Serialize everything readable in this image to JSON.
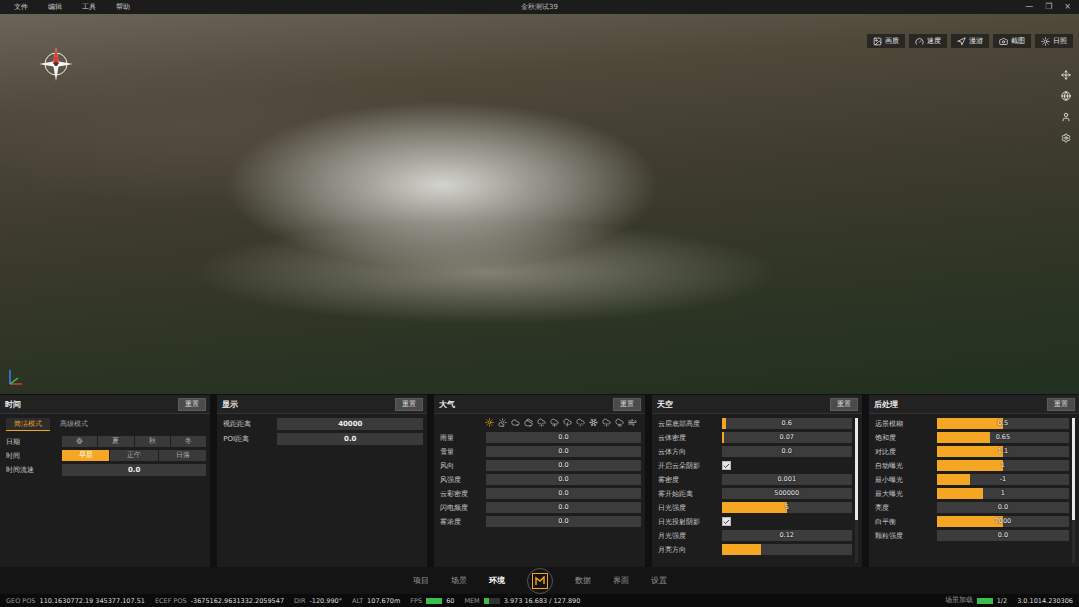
{
  "window": {
    "title": "金秋测试39",
    "menu": [
      "文件",
      "编辑",
      "工具",
      "帮助"
    ],
    "controls": [
      "—",
      "❐",
      "×"
    ]
  },
  "viewport_toolbar": [
    "画质",
    "速度",
    "漫游",
    "截图",
    "日照"
  ],
  "panels": [
    {
      "title": "时间",
      "reset": "重置",
      "scrollbar": false,
      "tabs": [
        {
          "label": "简洁模式",
          "selected": true
        },
        {
          "label": "高级模式",
          "selected": false
        }
      ],
      "rows": [
        {
          "kind": "segmented",
          "label": "日期",
          "options": [
            {
              "label": "春",
              "selected": false
            },
            {
              "label": "夏",
              "selected": false
            },
            {
              "label": "秋",
              "selected": false
            },
            {
              "label": "冬",
              "selected": false
            }
          ]
        },
        {
          "kind": "segmented",
          "label": "时间",
          "options": [
            {
              "label": "早晨",
              "selected": true
            },
            {
              "label": "正午",
              "selected": false
            },
            {
              "label": "日落",
              "selected": false
            }
          ]
        },
        {
          "kind": "field",
          "label": "时间流速",
          "value": "0.0"
        }
      ]
    },
    {
      "title": "显示",
      "reset": "重置",
      "scrollbar": false,
      "rows": [
        {
          "kind": "field",
          "label": "视距距离",
          "value": "40000"
        },
        {
          "kind": "field",
          "label": "POI距离",
          "value": "0.0"
        }
      ]
    },
    {
      "title": "大气",
      "reset": "重置",
      "scrollbar": false,
      "presets": [
        {
          "selected": true
        },
        {
          "selected": false
        },
        {
          "selected": false
        },
        {
          "selected": false
        },
        {
          "selected": false
        },
        {
          "selected": false
        },
        {
          "selected": false
        },
        {
          "selected": false
        },
        {
          "selected": false
        },
        {
          "selected": false
        },
        {
          "selected": false
        },
        {
          "selected": false
        }
      ],
      "rows": [
        {
          "kind": "slider",
          "label": "雨量",
          "value": "0.0",
          "level": 0
        },
        {
          "kind": "slider",
          "label": "雪量",
          "value": "0.0",
          "level": 0
        },
        {
          "kind": "slider",
          "label": "风向",
          "value": "0.0",
          "level": 0
        },
        {
          "kind": "slider",
          "label": "风强度",
          "value": "0.0",
          "level": 0
        },
        {
          "kind": "slider",
          "label": "云彩密度",
          "value": "0.0",
          "level": 0
        },
        {
          "kind": "slider",
          "label": "闪电频度",
          "value": "0.0",
          "level": 0
        },
        {
          "kind": "slider",
          "label": "雾浓度",
          "value": "0.0",
          "level": 0
        }
      ]
    },
    {
      "title": "天空",
      "reset": "重置",
      "scrollbar": true,
      "rows": [
        {
          "kind": "slider",
          "label": "云层底部高度",
          "value": "0.6",
          "level": 0.03
        },
        {
          "kind": "slider",
          "label": "云体密度",
          "value": "0.07",
          "level": 0.02
        },
        {
          "kind": "slider",
          "label": "云体方向",
          "value": "0.0",
          "level": 0
        },
        {
          "kind": "checkbox",
          "label": "开启云朵阴影",
          "checked": true
        },
        {
          "kind": "slider",
          "label": "雾密度",
          "value": "0.001",
          "level": 0
        },
        {
          "kind": "slider",
          "label": "雾开始距离",
          "value": "500000",
          "level": 0
        },
        {
          "kind": "slider",
          "label": "日光强度",
          "value": "5",
          "level": 0.5
        },
        {
          "kind": "checkbox",
          "label": "日光投射阴影",
          "checked": true
        },
        {
          "kind": "slider",
          "label": "月光强度",
          "value": "0.12",
          "level": 0
        },
        {
          "kind": "slider",
          "label": "月亮方向",
          "level": 0.3
        }
      ]
    },
    {
      "title": "后处理",
      "reset": "重置",
      "scrollbar": true,
      "rows": [
        {
          "kind": "slider",
          "label": "远景模糊",
          "value": "0.5",
          "level": 0.5
        },
        {
          "kind": "slider",
          "label": "饱和度",
          "value": "0.65",
          "level": 0.4
        },
        {
          "kind": "slider",
          "label": "对比度",
          "value": "1.1",
          "level": 0.5
        },
        {
          "kind": "slider",
          "label": "自动曝光",
          "value": "1",
          "level": 0.5
        },
        {
          "kind": "slider",
          "label": "最小曝光",
          "value": "-1",
          "level": 0.25
        },
        {
          "kind": "slider",
          "label": "最大曝光",
          "value": "1",
          "level": 0.35
        },
        {
          "kind": "slider",
          "label": "亮度",
          "value": "0.0",
          "level": 0
        },
        {
          "kind": "slider",
          "label": "白平衡",
          "value": "7000",
          "level": 0.5
        },
        {
          "kind": "slider",
          "label": "颗粒强度",
          "value": "0.0",
          "level": 0
        }
      ]
    }
  ],
  "nav": {
    "left": [
      {
        "label": "项目",
        "selected": false
      },
      {
        "label": "场景",
        "selected": false
      },
      {
        "label": "环境",
        "selected": true
      }
    ],
    "right": [
      {
        "label": "数据",
        "selected": false
      },
      {
        "label": "界面",
        "selected": false
      },
      {
        "label": "设置",
        "selected": false
      }
    ]
  },
  "status_bar": {
    "items": [
      {
        "kind": "text",
        "label": "GEO POS",
        "value": "110.1630772.19 345377.107.51"
      },
      {
        "kind": "text",
        "label": "ECEF POS",
        "value": "-3675162.9631332.2059547"
      },
      {
        "kind": "text",
        "label": "DIR",
        "value": "-120.990°"
      },
      {
        "kind": "text",
        "label": "ALT",
        "value": "107.670m"
      },
      {
        "kind": "meter",
        "label": "FPS",
        "value": "60",
        "level": 1
      },
      {
        "kind": "meter",
        "label": "MEM",
        "value": "3.973 16.683 / 127.890",
        "level": 0.3
      }
    ],
    "loading": {
      "label": "场景加载",
      "level": 1,
      "count": "1/2"
    },
    "version": "3.0.1014.230306"
  }
}
